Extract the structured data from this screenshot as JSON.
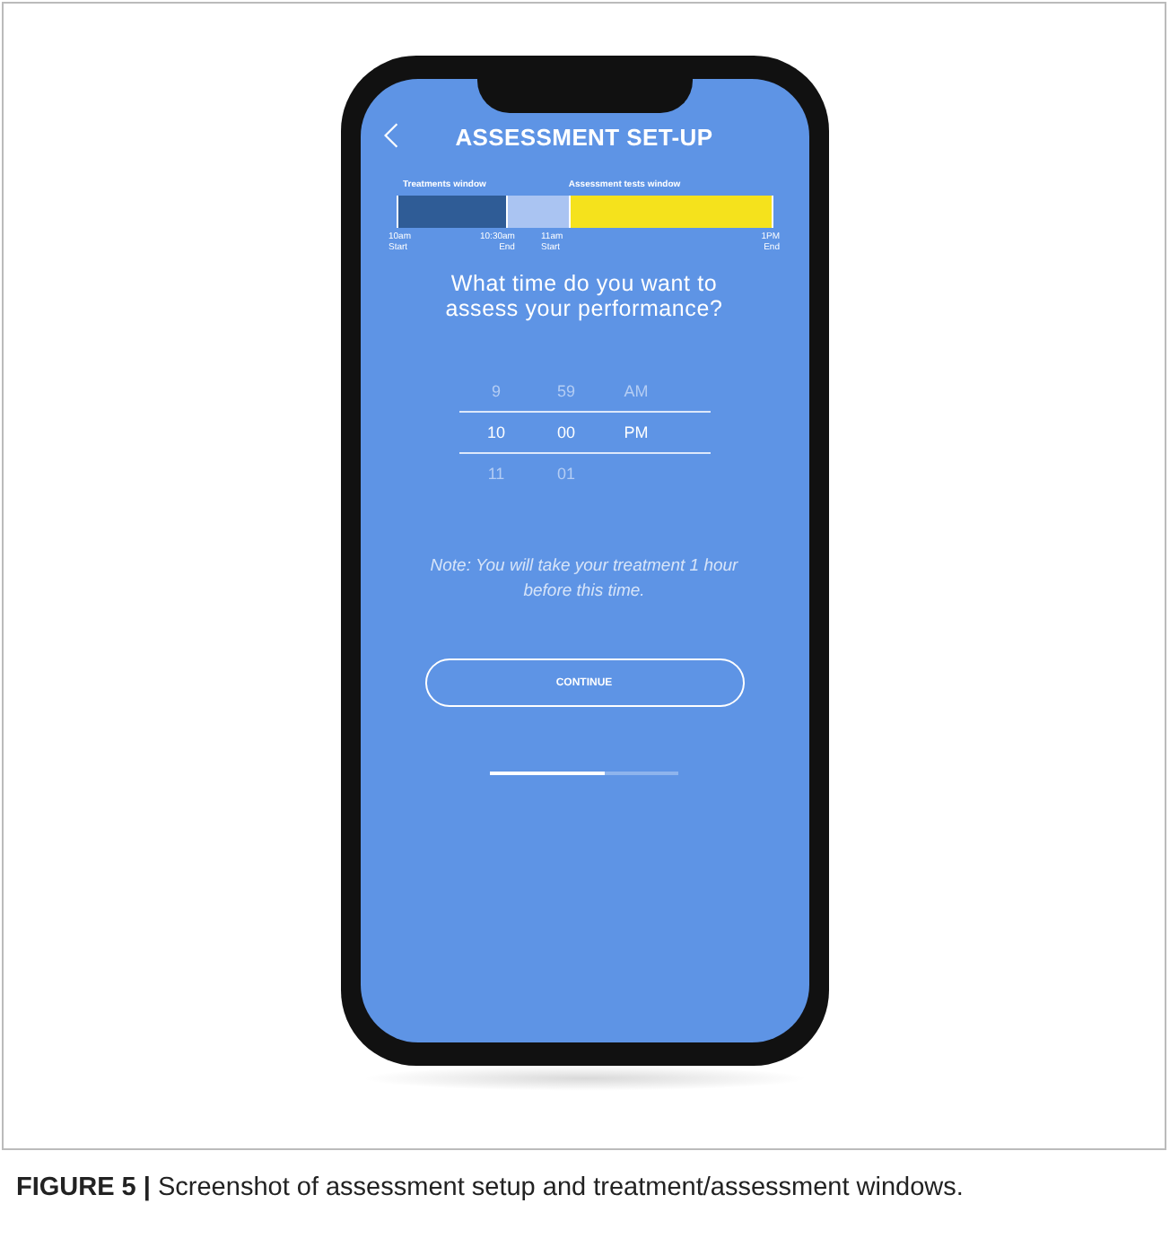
{
  "screen": {
    "title": "ASSESSMENT SET-UP",
    "timeline": {
      "treatment_label": "Treatments window",
      "assessment_label": "Assessment tests window",
      "segments": [
        {
          "kind": "treatment",
          "color": "#2f5c96"
        },
        {
          "kind": "gap",
          "color": "#aac4f2"
        },
        {
          "kind": "assessment",
          "color": "#f5e21c"
        }
      ],
      "ticks": [
        {
          "time": "10am",
          "label": "Start"
        },
        {
          "time": "10:30am",
          "label": "End"
        },
        {
          "time": "11am",
          "label": "Start"
        },
        {
          "time": "1PM",
          "label": "End"
        }
      ]
    },
    "question": "What time do you want to assess your performance?",
    "picker": [
      {
        "values": [
          "9",
          "59",
          "AM"
        ],
        "selected": false
      },
      {
        "values": [
          "10",
          "00",
          "PM"
        ],
        "selected": true
      },
      {
        "values": [
          "11",
          "01"
        ],
        "selected": false
      }
    ],
    "note": "Note: You will take your treatment 1 hour before this time.",
    "button": "CONTINUE",
    "progress": {
      "level": 0.61
    }
  },
  "caption": "**FIGURE 5 |** Screenshot of assessment setup and treatment/assessment windows."
}
